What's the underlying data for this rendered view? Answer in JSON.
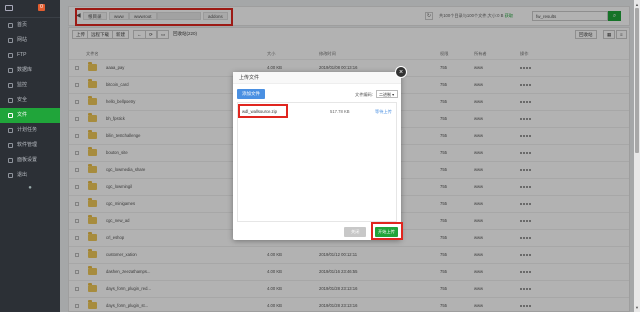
{
  "sidebar": {
    "badge": "0",
    "items": [
      {
        "label": "首页"
      },
      {
        "label": "网站"
      },
      {
        "label": "FTP"
      },
      {
        "label": "数据库"
      },
      {
        "label": "监控"
      },
      {
        "label": "安全"
      },
      {
        "label": "文件",
        "active": true
      },
      {
        "label": "计划任务"
      },
      {
        "label": "软件管理"
      },
      {
        "label": "面板设置"
      },
      {
        "label": "退出"
      }
    ]
  },
  "pathbar": {
    "crumbs": [
      "根目录",
      "www",
      "wwwroot",
      "addons"
    ],
    "disk_info": "共100个目录与100个文件,大小:0 B",
    "disk_link": "获取",
    "search_value": "fw_results"
  },
  "toolbar": {
    "upload": "上传",
    "remote_download": "远程下载",
    "new": "新建",
    "back": "←",
    "refresh": "⟳",
    "terminal": "▭",
    "recycle": "回收站(220)",
    "recycle_bin": "回收站"
  },
  "table": {
    "headers": [
      "文件名",
      "大小",
      "修改时间",
      "权限",
      "所有者",
      "操作"
    ],
    "rows": [
      {
        "name": "aaaa_pay",
        "size": "4.00 KB",
        "time": "2019/01/08 00:13:16",
        "perm": "755",
        "owner": "www"
      },
      {
        "name": "bitcoin_card",
        "size": "4.00 KB",
        "time": "2019/01/08 00:13:16",
        "perm": "755",
        "owner": "www"
      },
      {
        "name": "hello_bellpoetry",
        "size": "4.00 KB",
        "time": "2019/01/08 00:13:16",
        "perm": "755",
        "owner": "www"
      },
      {
        "name": "bh_fpstick",
        "size": "4.00 KB",
        "time": "2019/01/08 00:13:16",
        "perm": "755",
        "owner": "www"
      },
      {
        "name": "bilin_testchallenge",
        "size": "4.00 KB",
        "time": "2019/01/08 00:13:16",
        "perm": "755",
        "owner": "www"
      },
      {
        "name": "bouton_site",
        "size": "4.00 KB",
        "time": "2019/01/08 00:13:16",
        "perm": "755",
        "owner": "www"
      },
      {
        "name": "cgc_lowmedia_share",
        "size": "4.00 KB",
        "time": "2019/01/08 00:13:16",
        "perm": "755",
        "owner": "www"
      },
      {
        "name": "cgc_lowmingil",
        "size": "4.00 KB",
        "time": "2019/01/08 00:13:16",
        "perm": "755",
        "owner": "www"
      },
      {
        "name": "cgc_minigames",
        "size": "4.00 KB",
        "time": "2019/01/08 00:13:16",
        "perm": "755",
        "owner": "www"
      },
      {
        "name": "cgc_new_ad",
        "size": "4.00 KB",
        "time": "2019/01/08 00:13:16",
        "perm": "755",
        "owner": "www"
      },
      {
        "name": "crl_eshop",
        "size": "4.00 KB",
        "time": "2019/01/08 00:13:16",
        "perm": "755",
        "owner": "www"
      },
      {
        "name": "customer_xation",
        "size": "4.00 KB",
        "time": "2019/01/12 00:12:11",
        "perm": "755",
        "owner": "www"
      },
      {
        "name": "dashen_zeezathamps...",
        "size": "4.00 KB",
        "time": "2019/01/16 23:46:55",
        "perm": "755",
        "owner": "www"
      },
      {
        "name": "days_form_plugin_red...",
        "size": "4.00 KB",
        "time": "2019/01/28 23:13:16",
        "perm": "755",
        "owner": "www"
      },
      {
        "name": "days_form_plugin_st...",
        "size": "4.00 KB",
        "time": "2019/01/28 23:13:16",
        "perm": "755",
        "owner": "www"
      }
    ]
  },
  "modal": {
    "title": "上传文件",
    "close": "×",
    "add_file": "添加文件",
    "encoding_label": "文件编码:",
    "encoding_value": "二进制",
    "file": {
      "name": "wdl_wallsource.zip",
      "size": "517.78 KB",
      "status": "等待上传"
    },
    "cancel": "关闭",
    "start": "开始上传"
  }
}
